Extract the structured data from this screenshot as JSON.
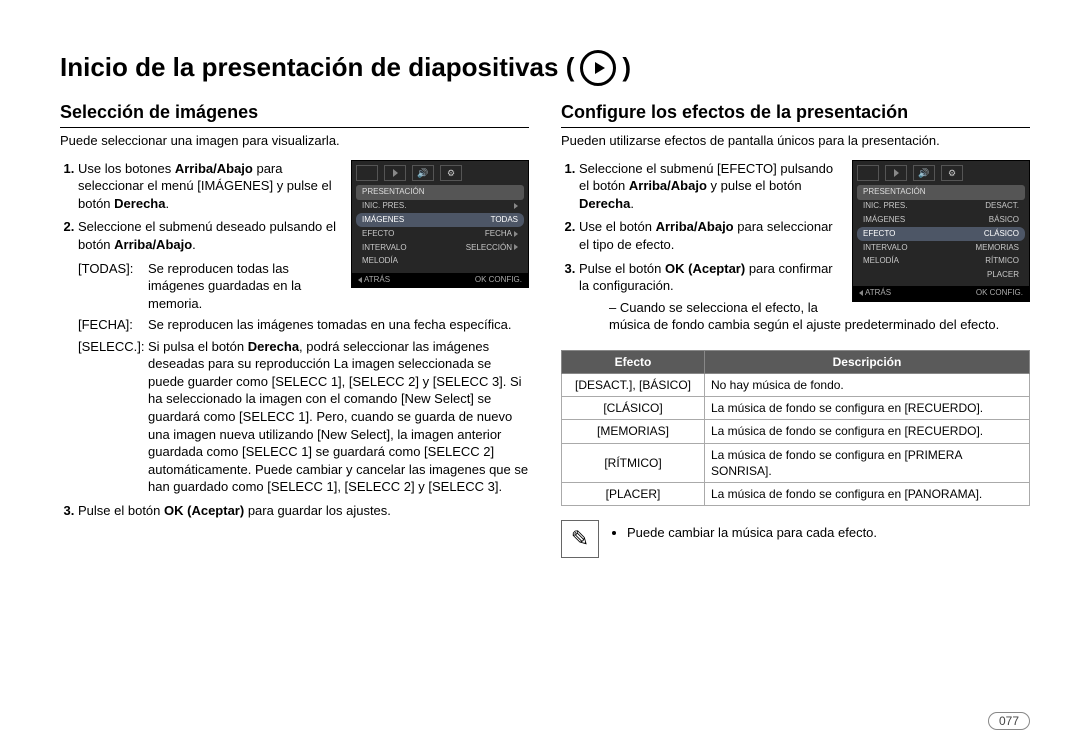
{
  "title": "Inicio de la presentación de diapositivas (",
  "title_close": ")",
  "pagenum": "077",
  "left": {
    "heading": "Selección de imágenes",
    "intro": "Puede seleccionar una imagen para visualizarla.",
    "step1_a": "Use los botones ",
    "step1_b": "Arriba/Abajo",
    "step1_c": " para seleccionar el menú [IMÁGENES] y pulse el botón ",
    "step1_d": "Derecha",
    "step1_e": ".",
    "step2_a": "Seleccione el submenú deseado pulsando el botón ",
    "step2_b": "Arriba/Abajo",
    "step2_c": ".",
    "defs": {
      "todas_t": "[TODAS]:",
      "todas_d": "Se reproducen todas las imágenes guardadas en la memoria.",
      "fecha_t": "[FECHA]:",
      "fecha_d": "Se reproducen las imágenes tomadas en una fecha específica.",
      "selecc_t": "[SELECC.]:",
      "selecc_d1": "Si pulsa el botón ",
      "selecc_d2": "Derecha",
      "selecc_d3": ", podrá seleccionar las imágenes deseadas para su reproducción La imagen seleccionada se puede guarder como [SELECC 1], [SELECC 2] y [SELECC 3]. Si ha seleccionado la imagen con el comando [New Select] se guardará como [SELECC 1]. Pero, cuando se guarda de nuevo una imagen nueva utilizando [New Select], la imagen anterior guardada como [SELECC 1] se guardará como [SELECC 2] automáticamente. Puede cambiar y cancelar las imagenes que se han guardado como [SELECC 1], [SELECC 2] y [SELECC 3]."
    },
    "step3_a": "Pulse el botón ",
    "step3_b": "OK (Aceptar)",
    "step3_c": " para guardar los ajustes.",
    "lcd": {
      "hdr": "PRESENTACIÓN",
      "r1l": "INIC. PRES.",
      "r1r": "",
      "r2l": "IMÁGENES",
      "r2r": "TODAS",
      "r3l": "EFECTO",
      "r3r": "FECHA",
      "r4l": "INTERVALO",
      "r4r": "SELECCIÓN",
      "r5l": "MELODÍA",
      "r5r": "",
      "fl": "ATRÁS",
      "fr": "OK  CONFIG."
    }
  },
  "right": {
    "heading": "Configure los efectos de la presentación",
    "intro": "Pueden utilizarse efectos de pantalla únicos para la presentación.",
    "step1_a": "Seleccione el submenú [EFECTO] pulsando el botón ",
    "step1_b": "Arriba/Abajo",
    "step1_c": " y pulse el botón ",
    "step1_d": "Derecha",
    "step1_e": ".",
    "step2_a": "Use el botón ",
    "step2_b": "Arriba/Abajo",
    "step2_c": " para seleccionar el tipo de efecto.",
    "step3_a": "Pulse el botón ",
    "step3_b": "OK (Aceptar)",
    "step3_c": " para confirmar la configuración.",
    "sub1": "Cuando se selecciona el efecto, la música de fondo cambia según el ajuste predeterminado del efecto.",
    "lcd": {
      "hdr": "PRESENTACIÓN",
      "r1l": "INIC. PRES.",
      "r1r": "DESACT.",
      "r2l": "IMÁGENES",
      "r2r": "BÁSICO",
      "r3l": "EFECTO",
      "r3r": "CLÁSICO",
      "r4l": "INTERVALO",
      "r4r": "MEMORIAS",
      "r5l": "MELODÍA",
      "r5r": "RÍTMICO",
      "r6r": "PLACER",
      "fl": "ATRÁS",
      "fr": "OK  CONFIG."
    },
    "table": {
      "th1": "Efecto",
      "th2": "Descripción",
      "rows": [
        {
          "e": "[DESACT.], [BÁSICO]",
          "d": "No hay música de fondo."
        },
        {
          "e": "[CLÁSICO]",
          "d": "La música de fondo se configura en [RECUERDO]."
        },
        {
          "e": "[MEMORIAS]",
          "d": "La música de fondo se configura en [RECUERDO]."
        },
        {
          "e": "[RÍTMICO]",
          "d": "La música de fondo se configura en [PRIMERA SONRISA]."
        },
        {
          "e": "[PLACER]",
          "d": "La música de fondo se configura en [PANORAMA]."
        }
      ]
    },
    "note": "Puede cambiar la música para cada efecto."
  }
}
